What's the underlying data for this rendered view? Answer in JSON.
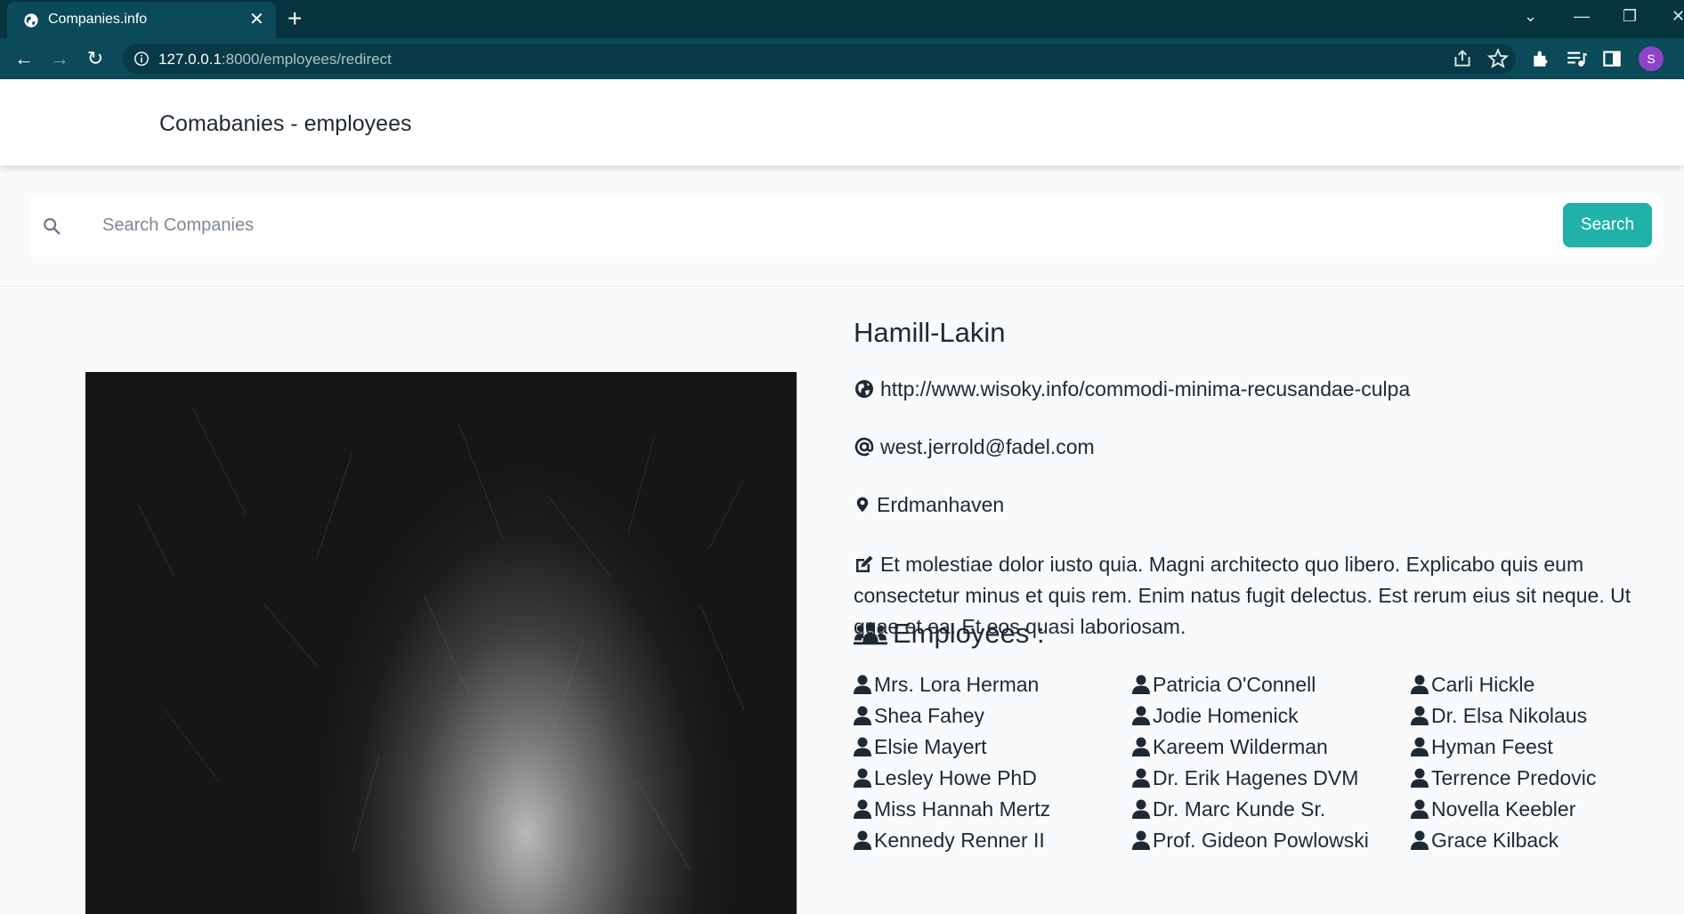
{
  "browser": {
    "tab_title": "Companies.info",
    "new_tab_label": "+",
    "url_host": "127.0.0.1",
    "url_path": ":8000/employees/redirect",
    "profile_initial": "S"
  },
  "header": {
    "brand": "Comabanies - employees"
  },
  "search": {
    "placeholder": "Search Companies",
    "value": "",
    "button_label": "Search"
  },
  "company": {
    "name": "Hamill-Lakin",
    "website": "http://www.wisoky.info/commodi-minima-recusandae-culpa",
    "email": "west.jerrold@fadel.com",
    "location": "Erdmanhaven",
    "description": "Et molestiae dolor iusto quia. Magni architecto quo libero. Explicabo quis eum consectetur minus et quis rem. Enim natus fugit delectus. Est rerum eius sit neque. Ut quae et ea. Et eos quasi laboriosam."
  },
  "employees": {
    "heading": "Employees :",
    "columns": [
      [
        "Mrs. Lora Herman",
        "Shea Fahey",
        "Elsie Mayert",
        "Lesley Howe PhD",
        "Miss Hannah Mertz",
        "Kennedy Renner II"
      ],
      [
        "Patricia O'Connell",
        "Jodie Homenick",
        "Kareem Wilderman",
        "Dr. Erik Hagenes DVM",
        "Dr. Marc Kunde Sr.",
        "Prof. Gideon Powlowski"
      ],
      [
        "Carli Hickle",
        "Dr. Elsa Nikolaus",
        "Hyman Feest",
        "Terrence Predovic",
        "Novella Keebler",
        "Grace Kilback"
      ]
    ]
  },
  "colors": {
    "chrome_dark": "#06343f",
    "chrome_toolbar": "#0b4a58",
    "accent_button": "#20b2a9",
    "page_bg": "#f8fafc"
  }
}
